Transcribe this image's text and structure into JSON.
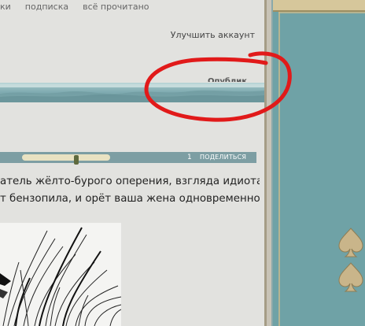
{
  "topnav": {
    "items": [
      "ки",
      "подписка",
      "всё прочитано"
    ]
  },
  "account": {
    "improve_label": "Улучшить аккаунт",
    "publish_label": "Опублик"
  },
  "post": {
    "count": "1",
    "share_label": "ПОДЕЛИТЬСЯ",
    "slider_value": 0.36,
    "text_lines": [
      "атель жёлто-бурого оперения, взгляда идиота",
      "т бензопила, и орёт ваша жена одновременно."
    ]
  },
  "colors": {
    "banner": "#7eaab0",
    "side_panel": "#6fa2a6",
    "annotation": "#e11a1a",
    "suit_ornament": "#c9b58a"
  },
  "icons": [
    "spade-icon",
    "spade-icon"
  ]
}
